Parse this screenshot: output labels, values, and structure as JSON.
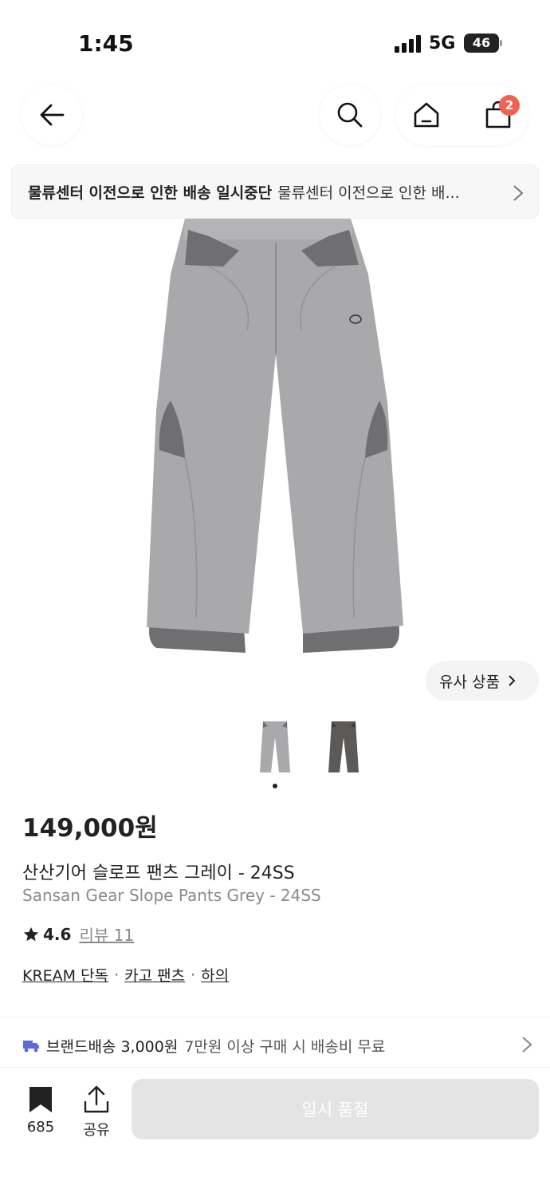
{
  "status_bar": {
    "time": "1:45",
    "network": "5G",
    "battery": "46"
  },
  "header": {
    "back_icon": "arrow-left-icon",
    "search_icon": "search-icon",
    "home_icon": "home-icon",
    "cart_icon": "shopping-bag-icon",
    "cart_badge": "2"
  },
  "notice": {
    "title": "물류센터 이전으로 인한 배송 일시중단",
    "description": "물류센터 이전으로 인한 배...",
    "chevron_icon": "chevron-right-icon"
  },
  "gallery": {
    "similar_button": "유사 상품",
    "thumbnails": [
      "grey-pants-thumbnail",
      "charcoal-pants-thumbnail"
    ],
    "active_index": 0
  },
  "product": {
    "price": "149,000원",
    "name_ko": "산산기어 슬로프 팬츠 그레이 - 24SS",
    "name_en": "Sansan Gear Slope Pants Grey - 24SS",
    "rating": "4.6",
    "review_label": "리뷰 11",
    "categories": [
      "KREAM 단독",
      "카고 팬츠",
      "하의"
    ],
    "separator": "·"
  },
  "shipping": {
    "icon": "truck-icon",
    "label": "브랜드배송 3,000원",
    "condition": "7만원 이상 구매 시 배송비 무료"
  },
  "bottom_bar": {
    "bookmark_count": "685",
    "share_label": "공유",
    "cta_label": "일시 품절"
  },
  "colors": {
    "badge": "#ef6253",
    "pants_main": "#a9a9ab",
    "pants_accent": "#6f6f72",
    "disabled_button": "#e4e4e4"
  }
}
